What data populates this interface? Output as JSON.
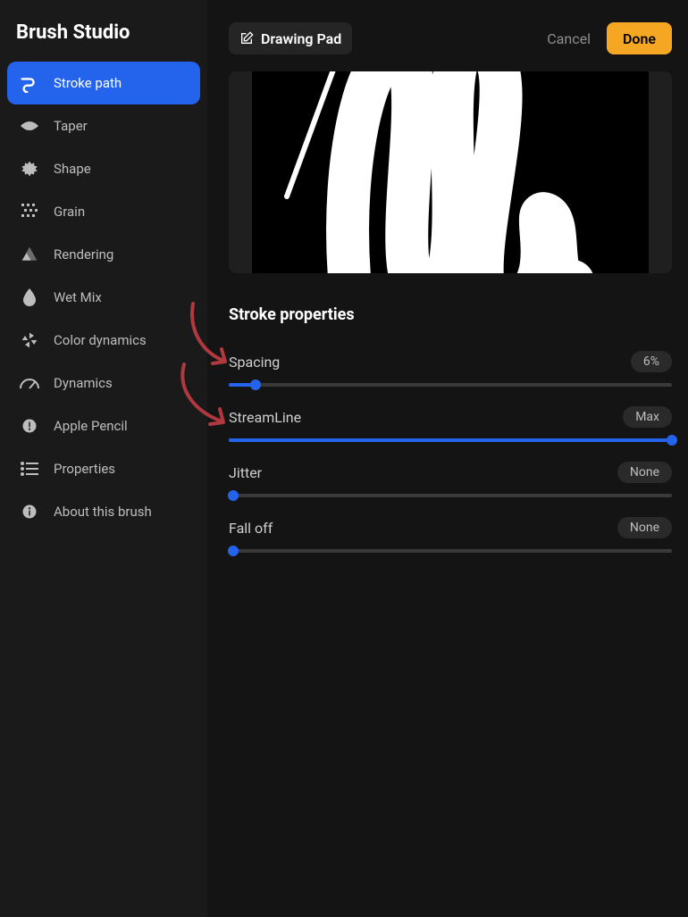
{
  "app": {
    "title": "Brush Studio"
  },
  "sidebar": {
    "items": [
      {
        "label": "Stroke path",
        "icon": "stroke-path-icon",
        "active": true
      },
      {
        "label": "Taper",
        "icon": "taper-icon",
        "active": false
      },
      {
        "label": "Shape",
        "icon": "shape-icon",
        "active": false
      },
      {
        "label": "Grain",
        "icon": "grain-icon",
        "active": false
      },
      {
        "label": "Rendering",
        "icon": "rendering-icon",
        "active": false
      },
      {
        "label": "Wet Mix",
        "icon": "wet-mix-icon",
        "active": false
      },
      {
        "label": "Color dynamics",
        "icon": "color-dynamics-icon",
        "active": false
      },
      {
        "label": "Dynamics",
        "icon": "dynamics-icon",
        "active": false
      },
      {
        "label": "Apple Pencil",
        "icon": "apple-pencil-icon",
        "active": false
      },
      {
        "label": "Properties",
        "icon": "properties-icon",
        "active": false
      },
      {
        "label": "About this brush",
        "icon": "about-icon",
        "active": false
      }
    ]
  },
  "topbar": {
    "drawing_pad_label": "Drawing Pad",
    "cancel_label": "Cancel",
    "done_label": "Done"
  },
  "section": {
    "title": "Stroke properties"
  },
  "sliders": [
    {
      "label": "Spacing",
      "value": "6%",
      "fill": 6
    },
    {
      "label": "StreamLine",
      "value": "Max",
      "fill": 100
    },
    {
      "label": "Jitter",
      "value": "None",
      "fill": 0
    },
    {
      "label": "Fall off",
      "value": "None",
      "fill": 0
    }
  ],
  "annotations": {
    "arrow_color": "#b0383f"
  }
}
